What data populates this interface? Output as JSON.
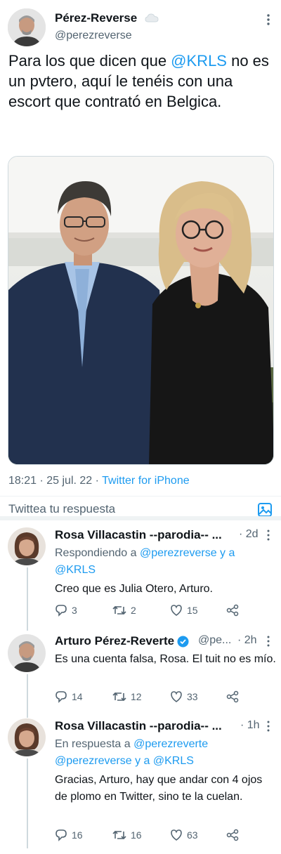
{
  "main_tweet": {
    "display_name": "Pérez-Reverse",
    "handle": "@perezreverse",
    "text_parts": [
      "Para los que dicen que ",
      "@KRLS",
      " no es un pvtero, aquí le tenéis con una escort que contrató en Belgica."
    ],
    "meta_time": "18:21 · 25 jul. 22 · ",
    "meta_source": "Twitter for iPhone"
  },
  "reply_box": {
    "placeholder": "Twittea tu respuesta"
  },
  "replies": [
    {
      "display_name": "Rosa Villacastin --parodia-- ...",
      "time": "· 2d",
      "context_label": "Respondiendo a ",
      "context_mentions": "@perezreverse y a @KRLS",
      "text": "Creo que es Julia Otero, Arturo.",
      "replies": "3",
      "retweets": "2",
      "likes": "15"
    },
    {
      "display_name": "Arturo Pérez-Reverte",
      "handle": "@pe...",
      "time": "· 2h",
      "text": "Es una cuenta falsa, Rosa. El tuit no es mío.",
      "replies": "14",
      "retweets": "12",
      "likes": "33"
    },
    {
      "display_name": "Rosa Villacastin --parodia-- ...",
      "time": "· 1h",
      "context_label": "En respuesta a ",
      "context_mentions": "@perezreverte @perezreverse y a @KRLS",
      "text": "Gracias, Arturo, hay que andar con 4 ojos de plomo en Twitter, sino te la cuelan.",
      "replies": "16",
      "retweets": "16",
      "likes": "63"
    }
  ],
  "colors": {
    "accent": "#1d9bf0",
    "muted": "#536471",
    "verified": "#1d9bf0"
  },
  "icons": [
    "more-icon",
    "cloud-icon",
    "reply-icon",
    "retweet-icon",
    "like-icon",
    "share-icon",
    "verified-icon",
    "image-icon"
  ]
}
